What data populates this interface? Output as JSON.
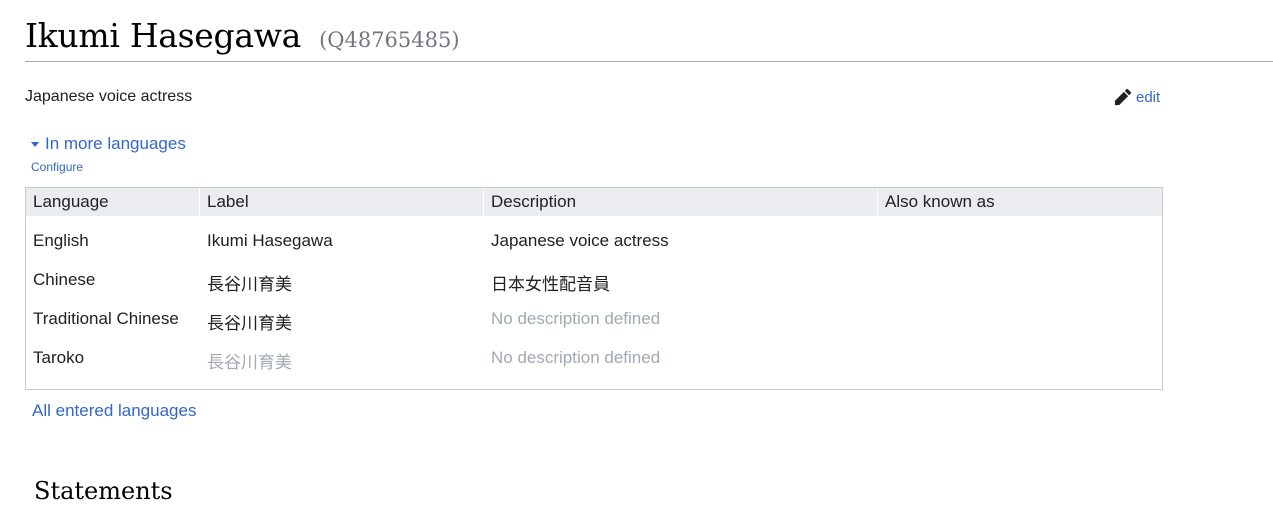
{
  "entity": {
    "label": "Ikumi Hasegawa",
    "id": "(Q48765485)",
    "description": "Japanese voice actress",
    "edit_label": "edit"
  },
  "languages": {
    "toggle_label": "In more languages",
    "configure_label": "Configure",
    "headers": [
      "Language",
      "Label",
      "Description",
      "Also known as"
    ],
    "rows": [
      {
        "language": "English",
        "label": "Ikumi Hasegawa",
        "label_muted": false,
        "description": "Japanese voice actress",
        "description_muted": false,
        "aliases": ""
      },
      {
        "language": "Chinese",
        "label": "長谷川育美",
        "label_muted": false,
        "description": "日本女性配音員",
        "description_muted": false,
        "aliases": ""
      },
      {
        "language": "Traditional Chinese",
        "label": "長谷川育美",
        "label_muted": false,
        "description": "No description defined",
        "description_muted": true,
        "aliases": ""
      },
      {
        "language": "Taroko",
        "label": "長谷川育美",
        "label_muted": true,
        "description": "No description defined",
        "description_muted": true,
        "aliases": ""
      }
    ],
    "all_languages_label": "All entered languages"
  },
  "statements_heading": "Statements",
  "colors": {
    "link": "#3366cc",
    "muted": "#a2a9b1",
    "header_bg": "#eaecf0"
  },
  "icons": {
    "edit": "pencil-icon",
    "toggle": "caret-down-icon"
  }
}
